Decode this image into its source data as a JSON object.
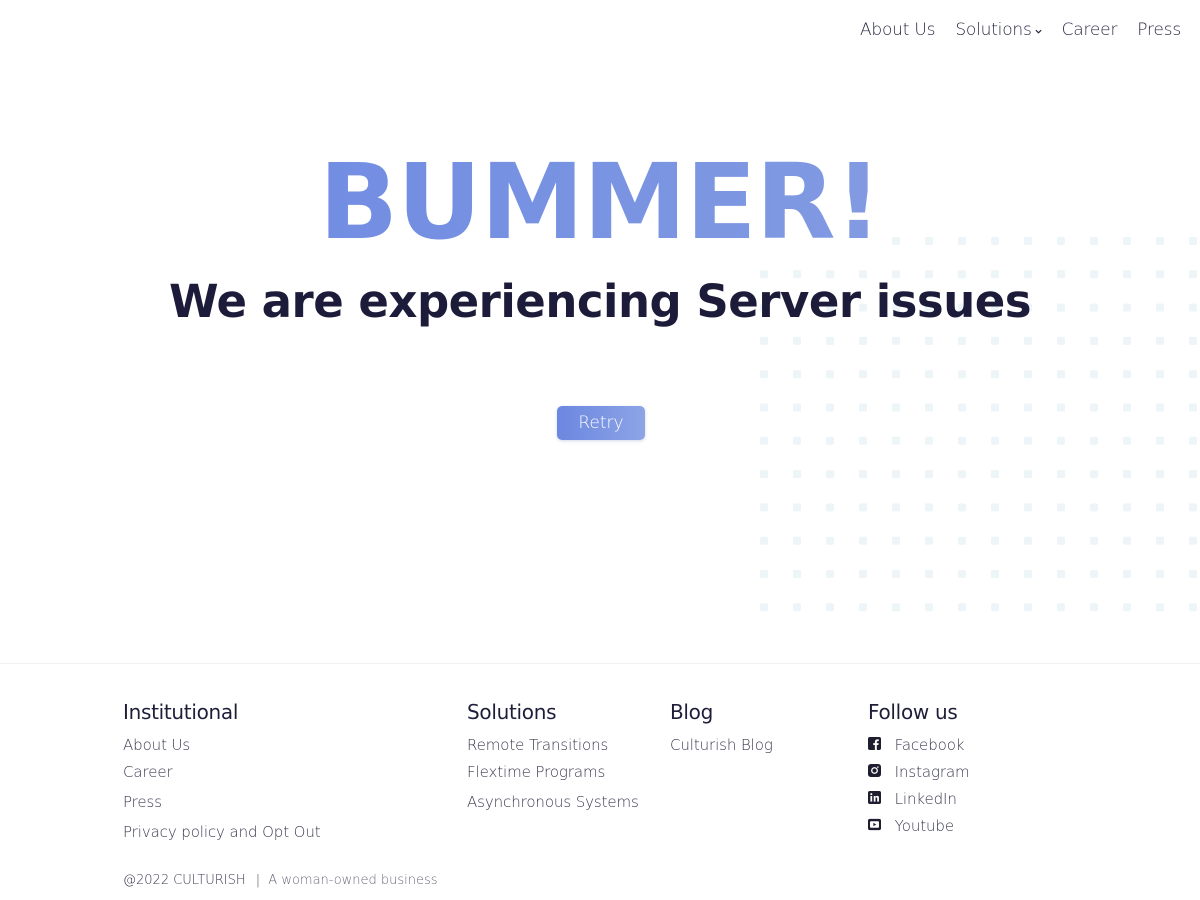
{
  "nav": {
    "items": [
      {
        "label": "About Us"
      },
      {
        "label": "Solutions"
      },
      {
        "label": "Career"
      },
      {
        "label": "Press"
      }
    ]
  },
  "hero": {
    "title": "BUMMER!",
    "subtitle": "We are experiencing Server issues",
    "retry_label": "Retry"
  },
  "footer": {
    "institutional": {
      "heading": "Institutional",
      "links": [
        "About Us",
        "Career",
        "Press",
        "Privacy policy and Opt Out"
      ]
    },
    "solutions": {
      "heading": "Solutions",
      "links": [
        "Remote Transitions",
        "Flextime Programs",
        "Asynchronous Systems"
      ]
    },
    "blog": {
      "heading": "Blog",
      "links": [
        "Culturish Blog"
      ]
    },
    "follow": {
      "heading": "Follow us",
      "links": [
        {
          "label": "Facebook",
          "icon": "facebook-icon"
        },
        {
          "label": "Instagram",
          "icon": "instagram-icon"
        },
        {
          "label": "LinkedIn",
          "icon": "linkedin-icon"
        },
        {
          "label": "Youtube",
          "icon": "youtube-icon"
        }
      ]
    },
    "copyright": "@2022 CULTURISH",
    "separator": "|",
    "tagline": "A woman-owned business"
  },
  "colors": {
    "accent": "#6b87e0",
    "text_dark": "#1c1c3a",
    "dots": "#eef5f8"
  }
}
